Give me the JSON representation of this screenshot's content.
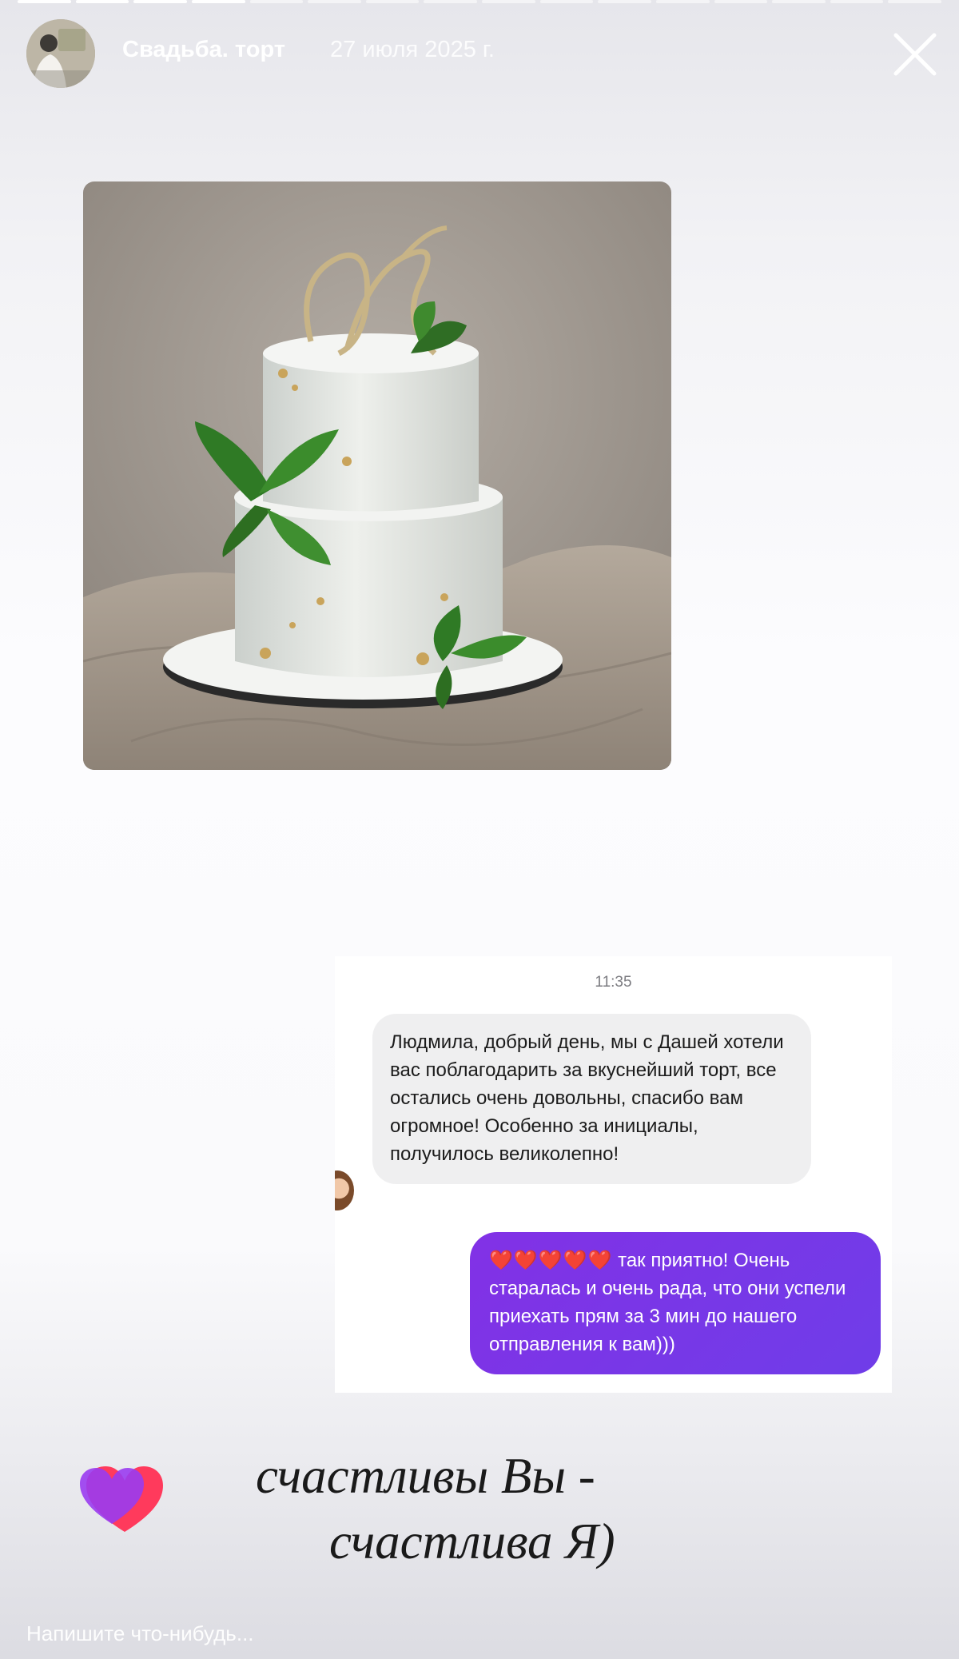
{
  "header": {
    "title": "Свадьба. торт",
    "date": "27 июля 2025 г.",
    "progress": {
      "segments": 16,
      "current": 5
    }
  },
  "chat": {
    "time": "11:35",
    "incoming": "Людмила, добрый день, мы с Дашей хотели вас поблагодарить за вкуснейший торт, все остались очень довольны, спасибо вам огромное! Особенно за инициалы, получилось великолепно!",
    "outgoing_hearts": "❤️❤️❤️❤️❤️",
    "outgoing": "так приятно! Очень старалась и очень рада, что они успели приехать прям за 3 мин до нашего отправления к вам)))"
  },
  "caption": {
    "line1": "счастливы Вы -",
    "line2": "счастлива Я)"
  },
  "reply": {
    "placeholder": "Напишите что-нибудь..."
  },
  "colors": {
    "outgoing_bubble": "#7b35e6",
    "incoming_bubble": "#efeff0",
    "heart_front": "#ff3a5c",
    "heart_back": "#9a3cf0"
  }
}
